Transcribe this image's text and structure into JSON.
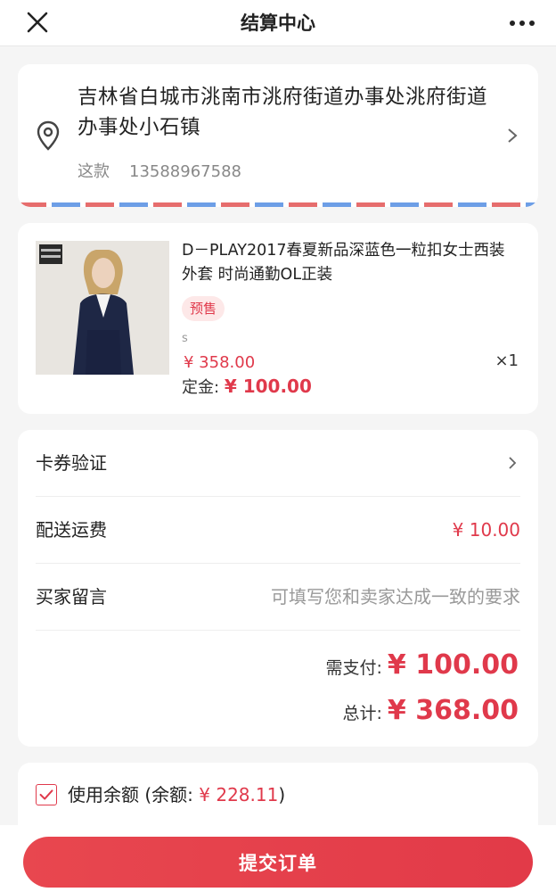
{
  "colors": {
    "accent": "#e0394b",
    "background": "#f5f5f5",
    "airmail_red": "#e66d6d",
    "airmail_blue": "#6d9ee6"
  },
  "nav": {
    "title": "结算中心",
    "close_icon": "close-icon",
    "more_icon": "more-icon"
  },
  "address": {
    "text": "吉林省白城市洮南市洮府街道办事处洮府街道办事处小石镇",
    "name": "这款",
    "phone": "13588967588",
    "pin_icon": "location-pin-icon",
    "arrow_icon": "chevron-right-icon"
  },
  "product": {
    "name": "D－PLAY2017春夏新品深蓝色一粒扣女士西装外套 时尚通勤OL正装",
    "tag": "预售",
    "sku": "s",
    "price": "¥ 358.00",
    "qty": "×1",
    "deposit_label": "定金:",
    "deposit_value": "¥ 100.00"
  },
  "summary": {
    "coupon_label": "卡券验证",
    "shipping_label": "配送运费",
    "shipping_value": "¥ 10.00",
    "message_label": "买家留言",
    "message_placeholder": "可填写您和卖家达成一致的要求",
    "pay_label": "需支付:",
    "pay_value": "¥ 100.00",
    "total_label": "总计:",
    "total_value": "¥ 368.00"
  },
  "balance": {
    "label": "使用余额 (余额:",
    "value": "¥ 228.11",
    "close": ")",
    "checked": true
  },
  "submit_label": "提交订单"
}
